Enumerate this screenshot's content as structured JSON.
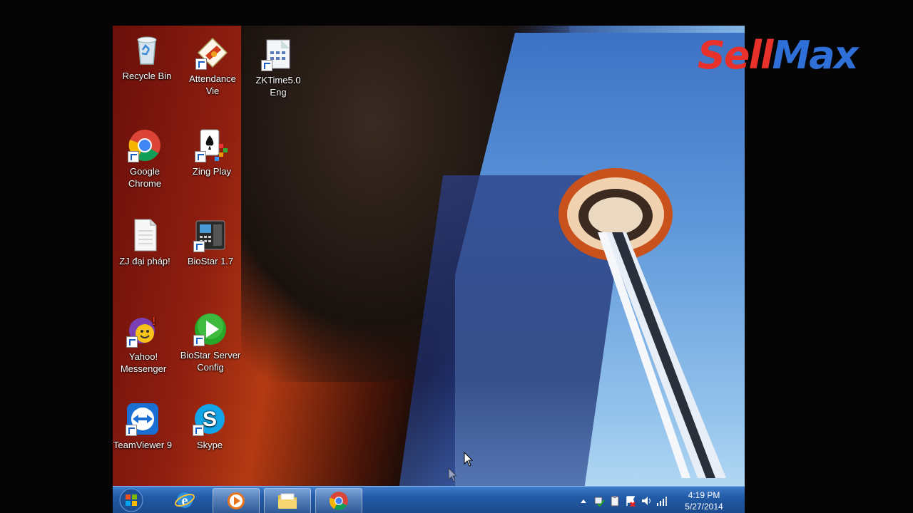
{
  "desktop": {
    "icons": [
      {
        "label": "Recycle Bin",
        "icon": "recycle-bin-icon"
      },
      {
        "label": "Attendance\nVie",
        "icon": "attendance-icon"
      },
      {
        "label": "ZKTime5.0\nEng",
        "icon": "zktime-icon"
      },
      {
        "label": "Google\nChrome",
        "icon": "chrome-icon"
      },
      {
        "label": "Zing Play",
        "icon": "zing-play-icon"
      },
      {
        "label": "ZJ đại pháp!",
        "icon": "document-icon"
      },
      {
        "label": "BioStar 1.7",
        "icon": "biostar-icon"
      },
      {
        "label": "Yahoo!\nMessenger",
        "icon": "yahoo-messenger-icon"
      },
      {
        "label": "BioStar Server\nConfig",
        "icon": "biostar-server-icon"
      },
      {
        "label": "TeamViewer 9",
        "icon": "teamviewer-icon"
      },
      {
        "label": "Skype",
        "icon": "skype-icon"
      }
    ]
  },
  "taskbar": {
    "buttons": [
      "start-orb-icon",
      "internet-explorer-icon",
      "media-player-icon",
      "file-explorer-icon",
      "chrome-icon"
    ],
    "tray": {
      "icons": [
        "show-hidden-icons-icon",
        "network-check-icon",
        "clipboard-icon",
        "action-center-flag-icon",
        "volume-icon",
        "signal-icon"
      ],
      "time": "4:19 PM",
      "date": "5/27/2014"
    }
  },
  "watermark": {
    "part1": "Sell",
    "part2": "Max"
  },
  "colors": {
    "taskbar": "#215aa6",
    "logo_red": "#e8312a",
    "logo_blue": "#2f6fd8"
  }
}
